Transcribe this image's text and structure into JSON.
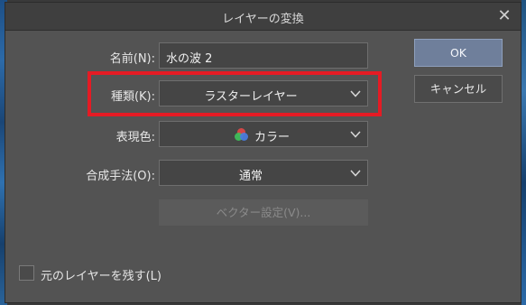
{
  "dialog": {
    "title": "レイヤーの変換",
    "close_label": "✕"
  },
  "form": {
    "name_label": "名前(N):",
    "name_value": "水の波 2",
    "type_label": "種類(K):",
    "type_value": "ラスターレイヤー",
    "expression_label": "表現色:",
    "expression_value": "カラー",
    "blend_label": "合成手法(O):",
    "blend_value": "通常",
    "vector_settings_label": "ベクター設定(V)..."
  },
  "buttons": {
    "ok": "OK",
    "cancel": "キャンセル"
  },
  "options": {
    "keep_original_label": "元のレイヤーを残す(L)",
    "keep_original_checked": false
  },
  "colors": {
    "dialog_bg": "#535353",
    "titlebar_bg": "#3f3f3f",
    "ok_bg": "#6f7f9b",
    "highlight": "#e51b24",
    "color_icon": [
      "#e04848",
      "#3fbf5a",
      "#4a7de0"
    ]
  }
}
